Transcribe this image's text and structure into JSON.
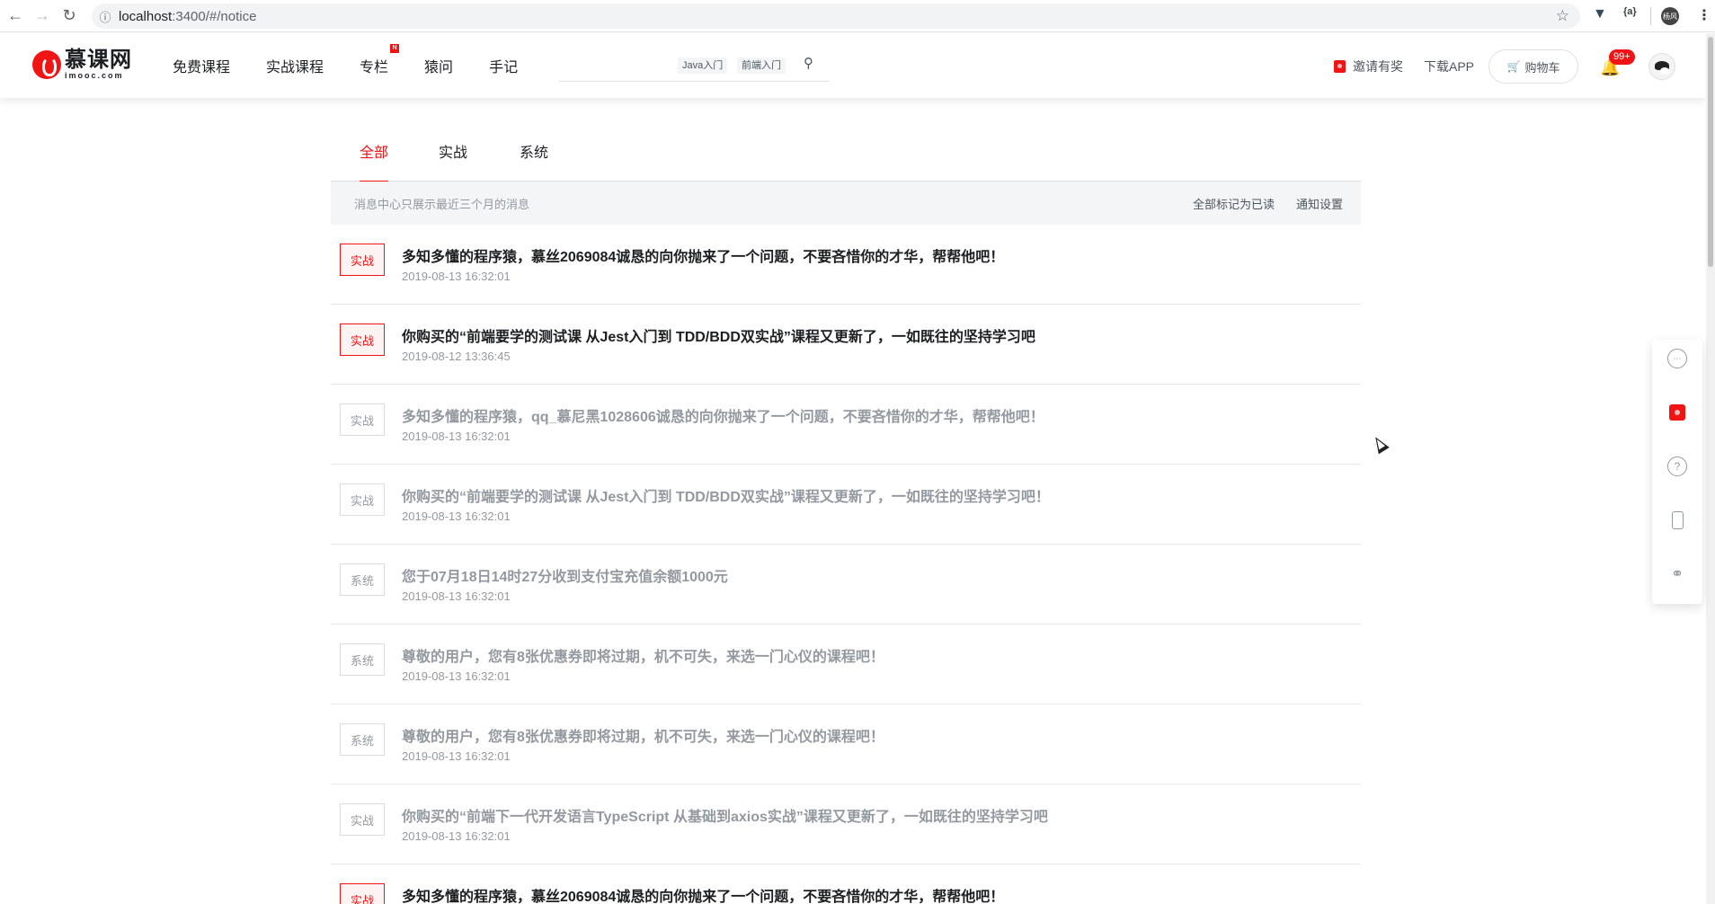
{
  "browser": {
    "url_host": "localhost",
    "url_path": ":3400/#/notice",
    "profile_label": "杨风"
  },
  "header": {
    "logo_cn": "慕课网",
    "logo_en": "imooc.com",
    "nav": [
      {
        "label": "免费课程"
      },
      {
        "label": "实战课程"
      },
      {
        "label": "专栏",
        "badge": "N"
      },
      {
        "label": "猿问"
      },
      {
        "label": "手记"
      }
    ],
    "search_tags": [
      "Java入门",
      "前端入门"
    ],
    "invite": "邀请有奖",
    "download": "下载APP",
    "cart": "购物车",
    "notification_count": "99+"
  },
  "tabs": [
    {
      "label": "全部",
      "active": true
    },
    {
      "label": "实战",
      "active": false
    },
    {
      "label": "系统",
      "active": false
    }
  ],
  "notice_bar": {
    "hint": "消息中心只展示最近三个月的消息",
    "mark_all": "全部标记为已读",
    "settings": "通知设置"
  },
  "messages": [
    {
      "tag": "实战",
      "title": "多知多懂的程序猿，慕丝2069084诚恳的向你抛来了一个问题，不要吝惜你的才华，帮帮他吧！",
      "time": "2019-08-13 16:32:01",
      "unread": true
    },
    {
      "tag": "实战",
      "title": "你购买的“前端要学的测试课 从Jest入门到 TDD/BDD双实战”课程又更新了，一如既往的坚持学习吧",
      "time": "2019-08-12 13:36:45",
      "unread": true
    },
    {
      "tag": "实战",
      "title": "多知多懂的程序猿，qq_慕尼黑1028606诚恳的向你抛来了一个问题，不要吝惜你的才华，帮帮他吧！",
      "time": "2019-08-13 16:32:01",
      "unread": false
    },
    {
      "tag": "实战",
      "title": "你购买的“前端要学的测试课 从Jest入门到 TDD/BDD双实战”课程又更新了，一如既往的坚持学习吧！",
      "time": "2019-08-13 16:32:01",
      "unread": false
    },
    {
      "tag": "系统",
      "title": "您于07月18日14时27分收到支付宝充值余额1000元",
      "time": "2019-08-13 16:32:01",
      "unread": false
    },
    {
      "tag": "系统",
      "title": "尊敬的用户，您有8张优惠券即将过期，机不可失，来选一门心仪的课程吧！",
      "time": "2019-08-13 16:32:01",
      "unread": false
    },
    {
      "tag": "系统",
      "title": "尊敬的用户，您有8张优惠券即将过期，机不可失，来选一门心仪的课程吧！",
      "time": "2019-08-13 16:32:01",
      "unread": false
    },
    {
      "tag": "实战",
      "title": "你购买的“前端下一代开发语言TypeScript 从基础到axios实战”课程又更新了，一如既往的坚持学习吧",
      "time": "2019-08-13 16:32:01",
      "unread": false
    },
    {
      "tag": "实战",
      "title": "多知多懂的程序猿，慕丝2069084诚恳的向你抛来了一个问题，不要吝惜你的才华，帮帮他吧！",
      "time": "",
      "unread": true
    }
  ],
  "float_bar": [
    "chat-icon",
    "gift-icon",
    "help-icon",
    "phone-icon",
    "wechat-icon"
  ]
}
